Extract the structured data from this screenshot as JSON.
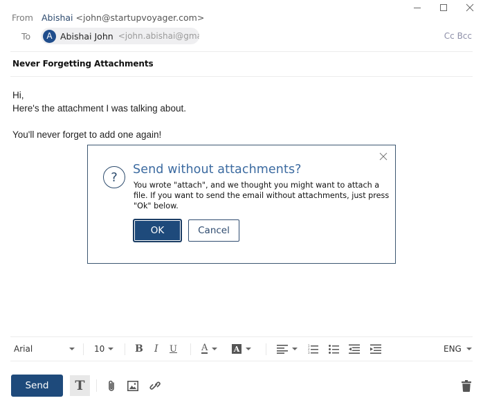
{
  "window": {
    "controls": [
      "minimize-icon",
      "maximize-icon",
      "close-icon"
    ]
  },
  "header": {
    "from_label": "From",
    "from_name": "Abishai",
    "from_email": "<john@startupvoyager.com>",
    "to_label": "To",
    "recipients": [
      {
        "avatar_initial": "A",
        "name": "Abishai John",
        "email": "<john.abishai@gma..."
      }
    ],
    "cc_bcc_label": "Cc Bcc"
  },
  "subject": "Never Forgetting Attachments",
  "body": {
    "lines": [
      "Hi,",
      "Here's the attachment I was talking about.",
      "",
      "You'll never forget to add one again!"
    ]
  },
  "dialog": {
    "icon": "question-icon",
    "title": "Send without attachments?",
    "message": "You wrote \"attach\", and we thought you might want to attach a file. If you want to send the email without attachments, just press \"Ok\" below.",
    "ok_label": "OK",
    "cancel_label": "Cancel"
  },
  "toolbar": {
    "font_family": "Arial",
    "font_size": "10",
    "language": "ENG",
    "icons": [
      "bold-icon",
      "italic-icon",
      "underline-icon",
      "text-color-icon",
      "highlight-color-icon",
      "align-icon",
      "numbered-list-icon",
      "bulleted-list-icon",
      "outdent-icon",
      "indent-icon"
    ]
  },
  "footer": {
    "send_label": "Send",
    "icons": [
      "format-toggle-icon",
      "attachment-icon",
      "image-icon",
      "link-icon",
      "trash-icon"
    ]
  },
  "colors": {
    "brand": "#1e4a7b",
    "dialog_title": "#3b6aa0",
    "avatar": "#1f4d8c"
  }
}
